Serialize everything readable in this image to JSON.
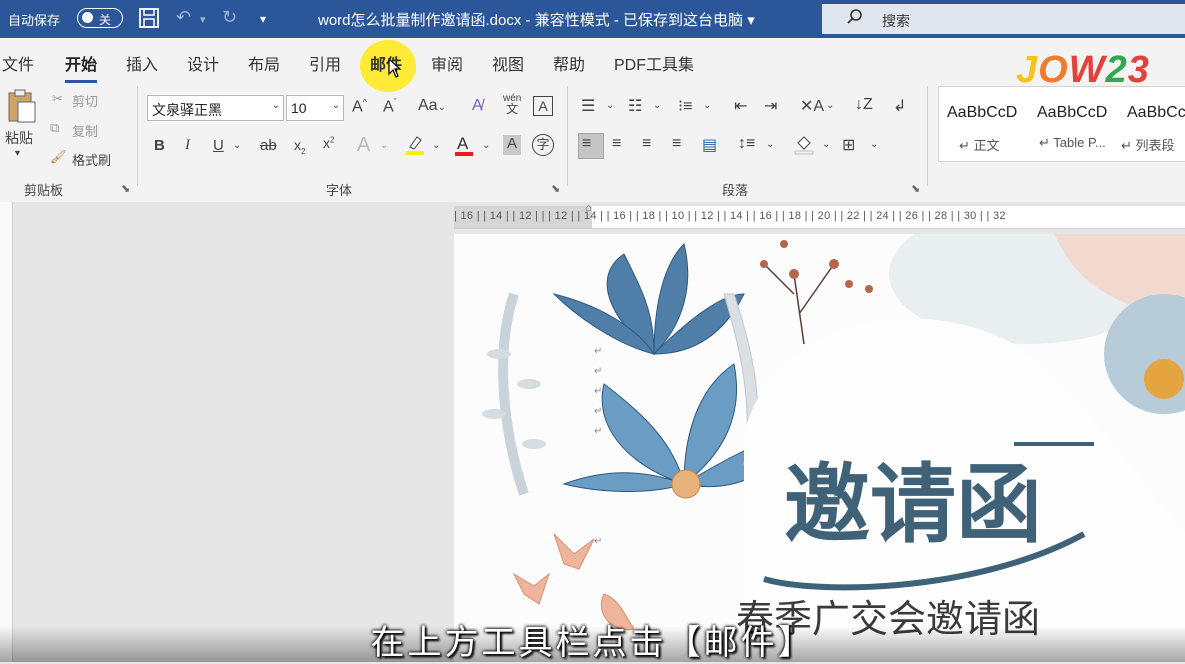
{
  "titlebar": {
    "autosave_label": "自动保存",
    "autosave_state": "关",
    "doc_title": "word怎么批量制作邀请函.docx  -  兼容性模式  -  已保存到这台电脑  ▾",
    "search_label": "搜索"
  },
  "tabs": [
    "文件",
    "开始",
    "插入",
    "设计",
    "布局",
    "引用",
    "邮件",
    "审阅",
    "视图",
    "帮助",
    "PDF工具集"
  ],
  "clipboard": {
    "paste": "粘贴",
    "cut": "剪切",
    "copy": "复制",
    "format_painter": "格式刷",
    "group_label": "剪贴板"
  },
  "font": {
    "name": "文泉驿正黑",
    "size": "10",
    "group_label": "字体"
  },
  "paragraph": {
    "group_label": "段落"
  },
  "styles": [
    {
      "sample": "AaBbCcD",
      "name": "↵ 正文"
    },
    {
      "sample": "AaBbCcD",
      "name": "↵ Table P..."
    },
    {
      "sample": "AaBbCc",
      "name": "↵ 列表段"
    }
  ],
  "ruler_numbers": "| 16 |  | 14 |  | 12 |  |  | 12 |  | 14 |  | 16 |  | 18 |  | 10 |  | 12 |  | 14 |  | 16 |  | 18 |  | 20 |  | 22 |  | 24 |  | 26 |  | 28 |  | 30 |  | 32",
  "document": {
    "heading": "邀请函",
    "subheading": "春季广交会邀请函"
  },
  "subtitle": "在上方工具栏点击【邮件】",
  "logo_text": "JOW23",
  "colors": {
    "title_bar": "#2b579a",
    "ribbon": "#f3f3f3",
    "highlight": "#ffe92b",
    "invitation_blue": "#3f6278"
  }
}
